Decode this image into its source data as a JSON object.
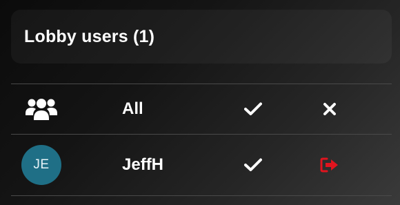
{
  "panel": {
    "title": "Lobby users (1)"
  },
  "rows": [
    {
      "icon": "users-group-icon",
      "name": "All",
      "approve_icon": "checkmark-icon",
      "deny_icon": "close-icon"
    },
    {
      "avatar_initials": "JE",
      "name": "JeffH",
      "approve_icon": "checkmark-icon",
      "deny_icon": "sign-out-icon"
    }
  ],
  "colors": {
    "avatar_bg": "#1f6f86",
    "deny_red": "#e0141e",
    "text": "#ffffff"
  }
}
